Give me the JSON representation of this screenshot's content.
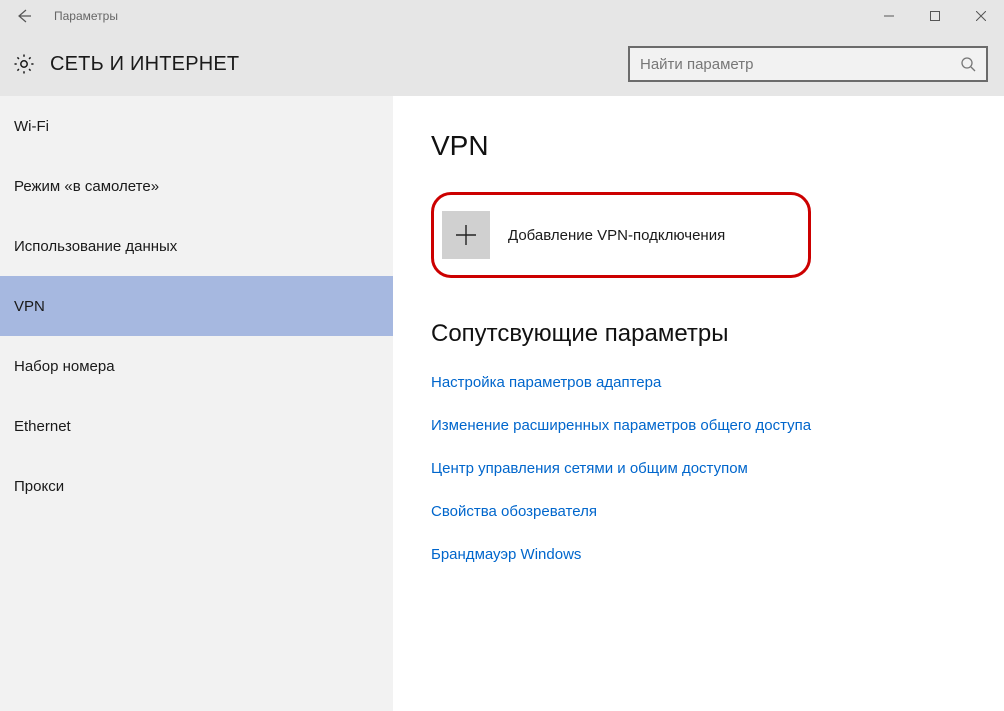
{
  "window": {
    "title": "Параметры"
  },
  "header": {
    "title": "СЕТЬ И ИНТЕРНЕТ",
    "search_placeholder": "Найти параметр"
  },
  "sidebar": {
    "items": [
      {
        "label": "Wi-Fi",
        "selected": false
      },
      {
        "label": "Режим «в самолете»",
        "selected": false
      },
      {
        "label": "Использование данных",
        "selected": false
      },
      {
        "label": "VPN",
        "selected": true
      },
      {
        "label": "Набор номера",
        "selected": false
      },
      {
        "label": "Ethernet",
        "selected": false
      },
      {
        "label": "Прокси",
        "selected": false
      }
    ]
  },
  "main": {
    "page_title": "VPN",
    "add_label": "Добавление VPN-подключения",
    "related_title": "Сопутсвующие параметры",
    "links": [
      "Настройка параметров адаптера",
      "Изменение расширенных параметров общего доступа",
      "Центр управления сетями и общим доступом",
      "Свойства обозревателя",
      "Брандмауэр Windows"
    ]
  }
}
